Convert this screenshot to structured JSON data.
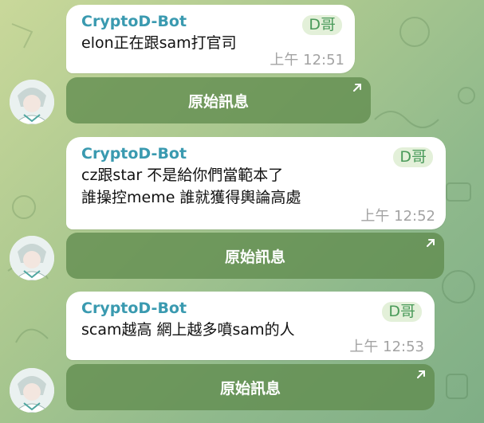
{
  "messages": [
    {
      "sender": "CryptoD-Bot",
      "tag": "D哥",
      "lines": [
        "elon正在跟sam打官司"
      ],
      "time": "上午 12:51",
      "button_label": "原始訊息"
    },
    {
      "sender": "CryptoD-Bot",
      "tag": "D哥",
      "lines": [
        "cz跟star 不是給你們當範本了",
        "誰操控meme 誰就獲得輿論高處"
      ],
      "time": "上午 12:52",
      "button_label": "原始訊息"
    },
    {
      "sender": "CryptoD-Bot",
      "tag": "D哥",
      "lines": [
        "scam越高 網上越多噴sam的人"
      ],
      "time": "上午 12:53",
      "button_label": "原始訊息"
    }
  ],
  "icons": {
    "button_arrow": "arrow-up-right-icon",
    "avatar": "bot-avatar"
  },
  "colors": {
    "sender": "#3a9ab0",
    "tag_bg": "#e3f0d9",
    "tag_text": "#4a9a5a",
    "button_bg": "#6b8f57",
    "time": "#a3a3a3"
  }
}
